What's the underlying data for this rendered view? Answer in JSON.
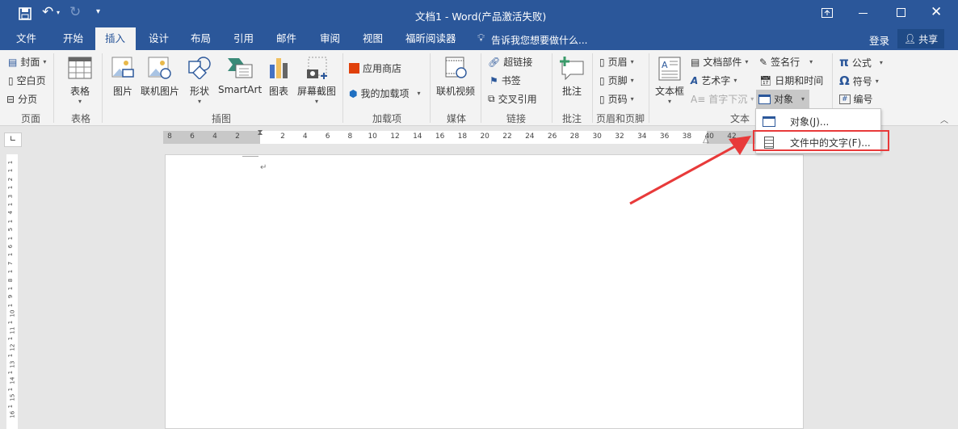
{
  "window": {
    "title": "文档1 - Word(产品激活失败)"
  },
  "qat": {
    "customize": "▾"
  },
  "tabs": [
    "文件",
    "开始",
    "插入",
    "设计",
    "布局",
    "引用",
    "邮件",
    "审阅",
    "视图",
    "福昕阅读器"
  ],
  "tell_me": "告诉我您想要做什么...",
  "signin": "登录",
  "share": "共享",
  "groups": {
    "page": {
      "label": "页面",
      "items": [
        "封面",
        "空白页",
        "分页"
      ]
    },
    "table": {
      "label": "表格",
      "item": "表格"
    },
    "illustrations": {
      "label": "插图",
      "items": [
        "图片",
        "联机图片",
        "形状",
        "SmartArt",
        "图表",
        "屏幕截图"
      ]
    },
    "addins": {
      "label": "加载项",
      "items": [
        "应用商店",
        "我的加载项"
      ]
    },
    "media": {
      "label": "媒体",
      "item": "联机视频"
    },
    "links": {
      "label": "链接",
      "items": [
        "超链接",
        "书签",
        "交叉引用"
      ]
    },
    "comments": {
      "label": "批注",
      "item": "批注"
    },
    "headerfooter": {
      "label": "页眉和页脚",
      "items": [
        "页眉",
        "页脚",
        "页码"
      ]
    },
    "text": {
      "label": "文本",
      "items": [
        "文本框",
        "文档部件",
        "艺术字",
        "首字下沉",
        "签名行",
        "日期和时间",
        "对象"
      ]
    },
    "symbols": {
      "items": [
        "公式",
        "符号",
        "编号"
      ]
    }
  },
  "menu": {
    "items": [
      "对象(J)...",
      "文件中的文字(F)..."
    ]
  },
  "ruler": {
    "left": [
      "8",
      "6",
      "4",
      "2"
    ],
    "right": [
      "2",
      "4",
      "6",
      "8",
      "10",
      "12",
      "14",
      "16",
      "18",
      "20",
      "22",
      "24",
      "26",
      "28",
      "30",
      "32",
      "34",
      "36",
      "38",
      "40",
      "42"
    ]
  },
  "vruler": [
    "1",
    "1",
    "2",
    "1",
    "3",
    "1",
    "4",
    "1",
    "5",
    "1",
    "6",
    "1",
    "7",
    "1",
    "8",
    "1",
    "9",
    "1",
    "10",
    "1",
    "11",
    "1",
    "12",
    "1",
    "13",
    "1",
    "14",
    "1",
    "15",
    "1",
    "16"
  ],
  "colors": {
    "brand": "#2b579a",
    "highlight": "#e83a3a"
  }
}
